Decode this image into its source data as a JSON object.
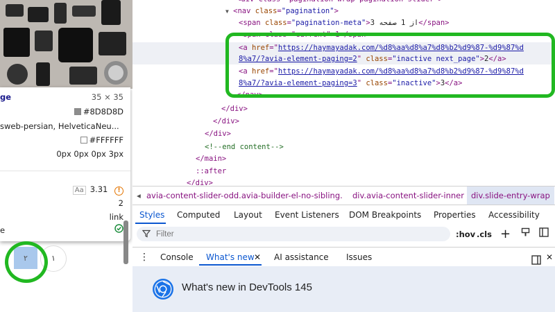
{
  "tooltip": {
    "title_fragment": "ge",
    "dimensions": "35 × 35",
    "color_value": "#8D8D8D",
    "color_swatch": "#8D8D8D",
    "font_fragment": "sweb-persian, HelveticaNeu...",
    "bg_value": "#FFFFFF",
    "bg_swatch": "#FFFFFF",
    "margin_value": "0px 0px 0px 3px",
    "contrast_icon_text": "Aa",
    "contrast_value": "3.31",
    "value_2": "2",
    "role_value": "link",
    "last_fragment": "e"
  },
  "pagination": {
    "current": "۲",
    "next": "۱"
  },
  "elements": {
    "nav_open_tag": "nav",
    "nav_class_val": "\"pagination\"",
    "meta_open": "span",
    "meta_class_val": "\"pagination-meta\"",
    "meta_text": "3 از 1 صفحه",
    "current_line": "<span class=\"current\">1</span>",
    "a1_href": "https://haymayadak.com/%d8%aa%d8%a7%d8%b2%d9%87-%d9%87%d8%a7/?avia-element-paging=2",
    "a1_href_line1": "https://haymayadak.com/%d8%aa%d8%a7%d8%b2%d9%87-%d9%87%d",
    "a1_href_line2": "8%a7/?avia-element-paging=2",
    "a1_class_val": "\"inactive next_page\"",
    "a1_text": "2",
    "a2_href_line1": "https://haymayadak.com/%d8%aa%d8%a7%d8%b2%d9%87-%d9%87%d",
    "a2_href_line2": "8%a7/?avia-element-paging=3",
    "a2_class_val": "\"inactive\"",
    "a2_text": "3",
    "close_nav": "</nav>",
    "close_div": "</div>",
    "comment": "<!--end content-->",
    "close_main": "</main>",
    "after": "::after"
  },
  "breadcrumbs": [
    "avia-content-slider-odd.avia-builder-el-no-sibling.",
    "div.avia-content-slider-inner",
    "div.slide-entry-wrap"
  ],
  "tabs": [
    "Styles",
    "Computed",
    "Layout",
    "Event Listeners",
    "DOM Breakpoints",
    "Properties",
    "Accessibility"
  ],
  "filter": {
    "placeholder": "Filter",
    "hov": ":hov",
    "cls": ".cls"
  },
  "drawer_tabs": [
    "Console",
    "What's new",
    "AI assistance",
    "Issues"
  ],
  "whats_new_title": "What's new in DevTools 145",
  "colors": {
    "highlight": "#21b821",
    "accent": "#0b57d0",
    "tag": "#881280",
    "attr": "#994500",
    "value": "#1a1aa6"
  }
}
